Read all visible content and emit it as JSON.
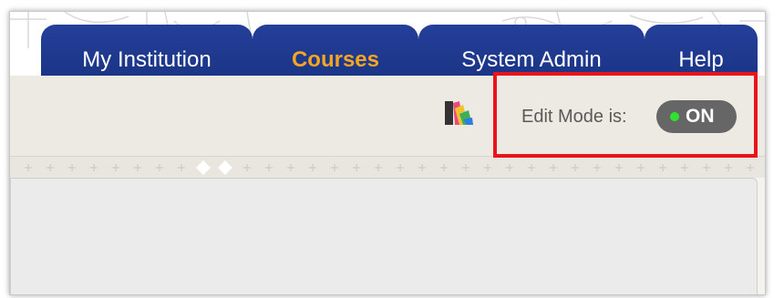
{
  "nav": {
    "tabs": [
      {
        "label": "My Institution",
        "active": false
      },
      {
        "label": "Courses",
        "active": true
      },
      {
        "label": "System Admin",
        "active": false
      },
      {
        "label": "Help",
        "active": false
      }
    ],
    "tab_color": "#1f3a93",
    "active_tab_text_color": "#f4a623"
  },
  "toolbar": {
    "theme_icon": "color-swatch-icon",
    "edit_mode_label": "Edit Mode is:",
    "edit_mode_state": "ON",
    "toggle_dot_color": "#31e22d"
  },
  "annotation": {
    "highlight_color": "#e8131b"
  }
}
